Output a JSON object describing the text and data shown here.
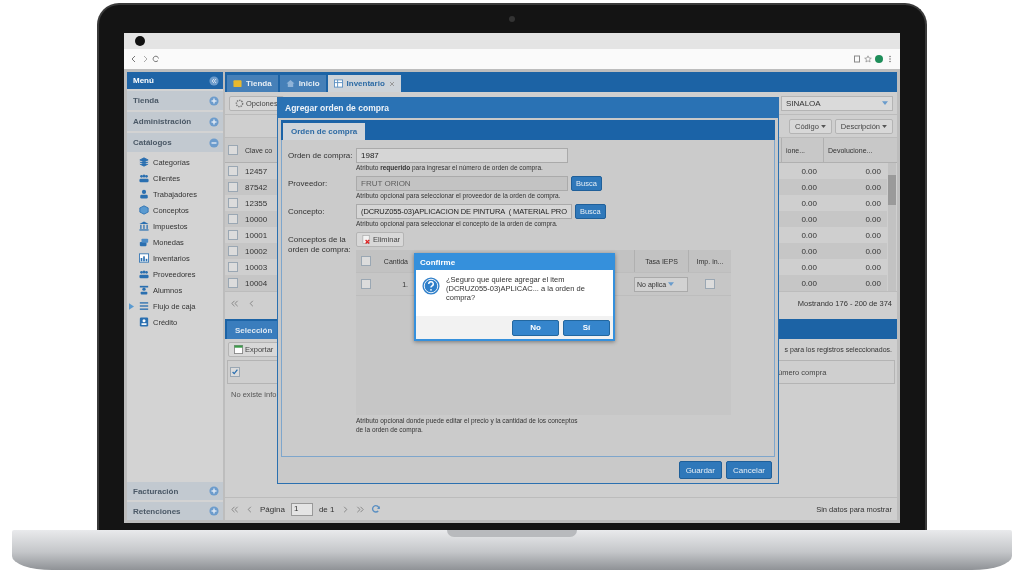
{
  "sidebar": {
    "title": "Menú",
    "sections": [
      {
        "label": "Tienda",
        "expanded": false
      },
      {
        "label": "Administración",
        "expanded": false
      },
      {
        "label": "Catálogos",
        "expanded": true,
        "items": [
          {
            "label": "Categorías",
            "kind": "leaf"
          },
          {
            "label": "Clientes",
            "kind": "leaf"
          },
          {
            "label": "Trabajadores",
            "kind": "leaf"
          },
          {
            "label": "Conceptos",
            "kind": "leaf"
          },
          {
            "label": "Impuestos",
            "kind": "leaf"
          },
          {
            "label": "Monedas",
            "kind": "leaf"
          },
          {
            "label": "Inventarios",
            "kind": "leaf"
          },
          {
            "label": "Proveedores",
            "kind": "leaf"
          },
          {
            "label": "Alumnos",
            "kind": "leaf"
          },
          {
            "label": "Flujo de caja",
            "kind": "group"
          },
          {
            "label": "Crédito",
            "kind": "leaf"
          }
        ]
      }
    ],
    "bottom_sections": [
      {
        "label": "Facturación",
        "expanded": false
      },
      {
        "label": "Retenciones",
        "expanded": false
      }
    ]
  },
  "tabs": [
    {
      "label": "Tienda",
      "selected": false,
      "closable": false
    },
    {
      "label": "Inicio",
      "selected": false,
      "closable": false
    },
    {
      "label": "Inventario",
      "selected": true,
      "closable": true
    }
  ],
  "toolbar": {
    "options_button": "Opciones",
    "branch": "SINALOA",
    "sort_buttons": [
      "Código",
      "Descripción"
    ]
  },
  "inventory_table": {
    "header_checked": false,
    "columns": [
      "Clave co",
      "ione...",
      "Devolucione..."
    ],
    "rows": [
      {
        "checked": false,
        "cells": [
          "12457",
          "0.00",
          "0.00"
        ]
      },
      {
        "checked": false,
        "cells": [
          "87542",
          "0.00",
          "0.00"
        ]
      },
      {
        "checked": false,
        "cells": [
          "12355",
          "0.00",
          "0.00"
        ]
      },
      {
        "checked": false,
        "cells": [
          "10000",
          "0.00",
          "0.00"
        ]
      },
      {
        "checked": false,
        "cells": [
          "10001",
          "0.00",
          "0.00"
        ]
      },
      {
        "checked": false,
        "cells": [
          "10002",
          "0.00",
          "0.00"
        ]
      },
      {
        "checked": false,
        "cells": [
          "10003",
          "0.00",
          "0.00"
        ]
      },
      {
        "checked": false,
        "cells": [
          "10004",
          "0.00",
          "0.00"
        ]
      }
    ],
    "status": "Mostrando 176 - 200 de 374"
  },
  "selection": {
    "tab": "Selección",
    "export_button": "Exportar",
    "note": "s para los registros seleccionados.",
    "header_checked": true,
    "column": "úmero compra",
    "empty_text": "No existe info",
    "pager": {
      "page_label": "Página",
      "page": "1",
      "of": "de 1",
      "status": "Sin datos para mostrar"
    }
  },
  "dialog": {
    "title": "Agregar orden de compra",
    "tab": "Orden de compra",
    "fields": [
      {
        "label": "Orden de compra:",
        "value": "1987",
        "disabled": false,
        "hint": "Atributo **requerido** para ingresar el número de orden de compra."
      },
      {
        "label": "Proveedor:",
        "value": "FRUT ORION",
        "disabled": true,
        "button": "Busca",
        "hint": "Atributo opcional para seleccionar el proveedor de la orden de compra."
      },
      {
        "label": "Concepto:",
        "value": "(DCRUZ055-03)APLICACION DE PINTURA  ( MATERIAL PRO",
        "disabled": false,
        "button": "Busca",
        "hint": "Atributo opcional para seleccionar el concepto de la orden de compra."
      }
    ],
    "concepts": {
      "label": "Conceptos de la orden de compra:",
      "delete_button": "Eliminar",
      "header_checked": false,
      "columns": [
        "Cantida",
        "Tasa IEPS",
        "Imp. in..."
      ],
      "rows": [
        {
          "checked": false,
          "quantity": "1.",
          "ieps": "No aplica",
          "included": false
        }
      ],
      "hint": "Atributo opcional donde puede editar el precio y la cantidad de los conceptos de la orden de compra."
    },
    "buttons": [
      "Guardar",
      "Cancelar"
    ]
  },
  "confirm": {
    "title": "Confirme",
    "message": "¿Seguro que quiere agregar el item (DCRUZ055-03)APLICAC... a la orden de compra?",
    "buttons": [
      "No",
      "Sí"
    ]
  }
}
